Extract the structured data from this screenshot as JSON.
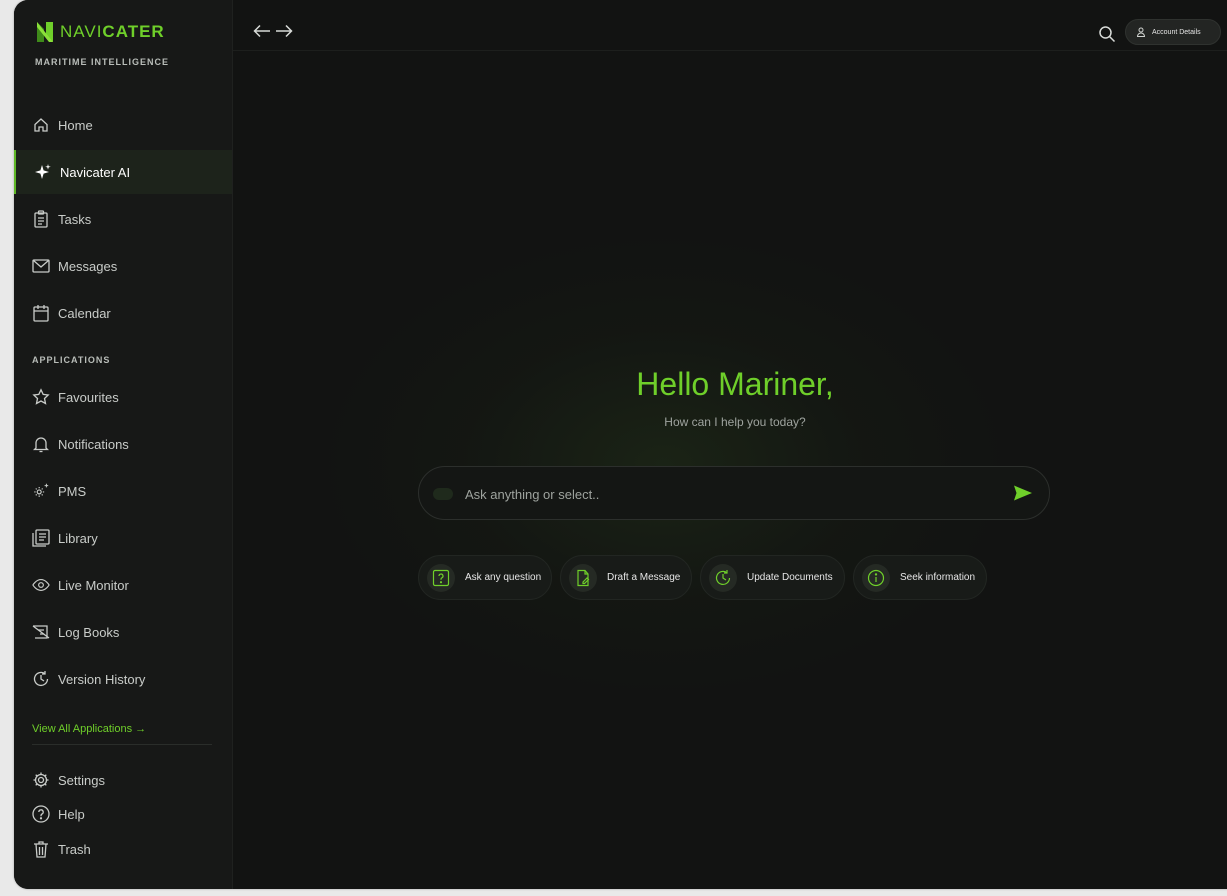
{
  "brand": {
    "name_part1": "NAVI",
    "name_part2": "CATER",
    "tagline": "MARITIME INTELLIGENCE"
  },
  "sidebar": {
    "main_items": [
      {
        "label": "Home",
        "icon": "home-icon"
      },
      {
        "label": "Navicater AI",
        "icon": "sparkle-icon",
        "active": true
      },
      {
        "label": "Tasks",
        "icon": "clipboard-icon"
      },
      {
        "label": "Messages",
        "icon": "mail-icon"
      },
      {
        "label": "Calendar",
        "icon": "calendar-icon"
      }
    ],
    "section_label": "APPLICATIONS",
    "app_items": [
      {
        "label": "Favourites",
        "icon": "star-icon"
      },
      {
        "label": "Notifications",
        "icon": "bell-icon"
      },
      {
        "label": "PMS",
        "icon": "gear-sparkle-icon"
      },
      {
        "label": "Library",
        "icon": "library-icon"
      },
      {
        "label": "Live Monitor",
        "icon": "eye-icon"
      },
      {
        "label": "Log Books",
        "icon": "logbook-icon"
      },
      {
        "label": "Version History",
        "icon": "history-icon"
      }
    ],
    "view_all": "View All Applications →",
    "bottom_items": [
      {
        "label": "Settings",
        "icon": "gear-icon"
      },
      {
        "label": "Help",
        "icon": "help-icon"
      },
      {
        "label": "Trash",
        "icon": "trash-icon"
      }
    ]
  },
  "topbar": {
    "account_label": "Account Details"
  },
  "main": {
    "greeting": "Hello Mariner,",
    "subtitle": "How can I help you today?",
    "input_placeholder": "Ask anything or select..",
    "chips": [
      {
        "label": "Ask any question",
        "icon": "question-icon"
      },
      {
        "label": "Draft a Message",
        "icon": "draft-icon"
      },
      {
        "label": "Update Documents",
        "icon": "update-icon"
      },
      {
        "label": "Seek information",
        "icon": "info-icon"
      }
    ]
  },
  "colors": {
    "accent": "#6fcf2a",
    "background": "#121312",
    "sidebar": "#171817",
    "page": "#e9e9e9"
  }
}
